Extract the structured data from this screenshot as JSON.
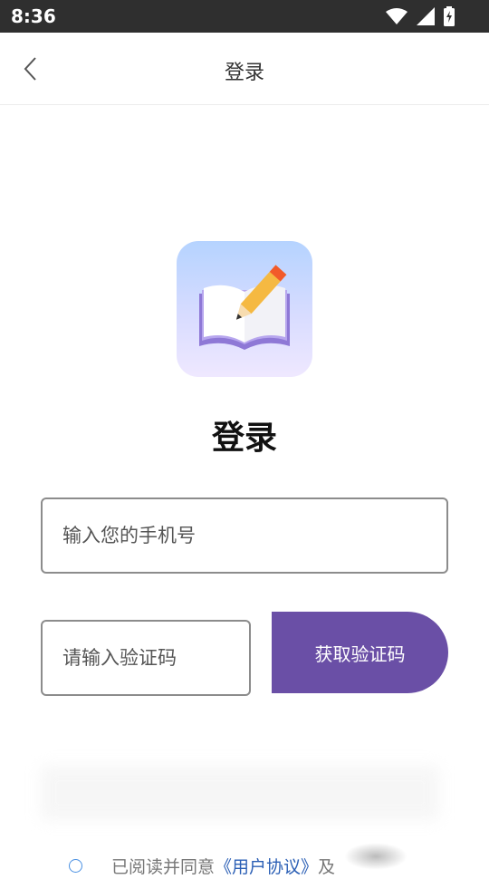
{
  "status_bar": {
    "time": "8:36"
  },
  "navbar": {
    "title": "登录"
  },
  "main": {
    "heading": "登录",
    "phone_placeholder": "输入您的手机号",
    "code_placeholder": "请输入验证码",
    "get_code_label": "获取验证码"
  },
  "agreement": {
    "prefix": "已阅读并同意",
    "user_agreement": "《用户协议》",
    "conjunction": "及"
  },
  "colors": {
    "accent": "#6a4fa6",
    "link": "#2b5fb5",
    "status_bar_bg": "#2f2f2f"
  },
  "icons": [
    "wifi-icon",
    "signal-icon",
    "battery-icon",
    "back-arrow-icon",
    "book-pencil-logo"
  ]
}
